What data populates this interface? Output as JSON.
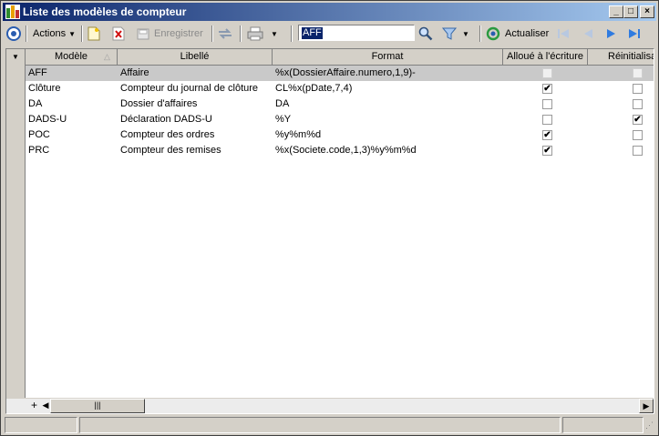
{
  "window": {
    "title": "Liste des modèles de compteur"
  },
  "toolbar": {
    "actions_label": "Actions",
    "save_label": "Enregistrer",
    "search_value": "AFF",
    "refresh_label": "Actualiser"
  },
  "grid": {
    "columns": [
      "Modèle",
      "Libellé",
      "Format",
      "Alloué à l'écriture",
      "Réinitialisa"
    ],
    "rows": [
      {
        "modele": "AFF",
        "libelle": "Affaire",
        "format": "%x(DossierAffaire.numero,1,9)-",
        "alloue": false,
        "reinit": false
      },
      {
        "modele": "Clôture",
        "libelle": "Compteur du journal de clôture",
        "format": "CL%x(pDate,7,4)",
        "alloue": true,
        "reinit": false
      },
      {
        "modele": "DA",
        "libelle": "Dossier d'affaires",
        "format": "DA",
        "alloue": false,
        "reinit": false
      },
      {
        "modele": "DADS-U",
        "libelle": "Déclaration DADS-U",
        "format": "%Y",
        "alloue": false,
        "reinit": true
      },
      {
        "modele": "POC",
        "libelle": "Compteur des ordres",
        "format": "%y%m%d",
        "alloue": true,
        "reinit": false
      },
      {
        "modele": "PRC",
        "libelle": "Compteur des remises",
        "format": "%x(Societe.code,1,3)%y%m%d",
        "alloue": true,
        "reinit": false
      }
    ]
  },
  "colors": {
    "title_start": "#0a246a",
    "title_end": "#a6caf0",
    "selected_row": "#c9c9c9"
  }
}
